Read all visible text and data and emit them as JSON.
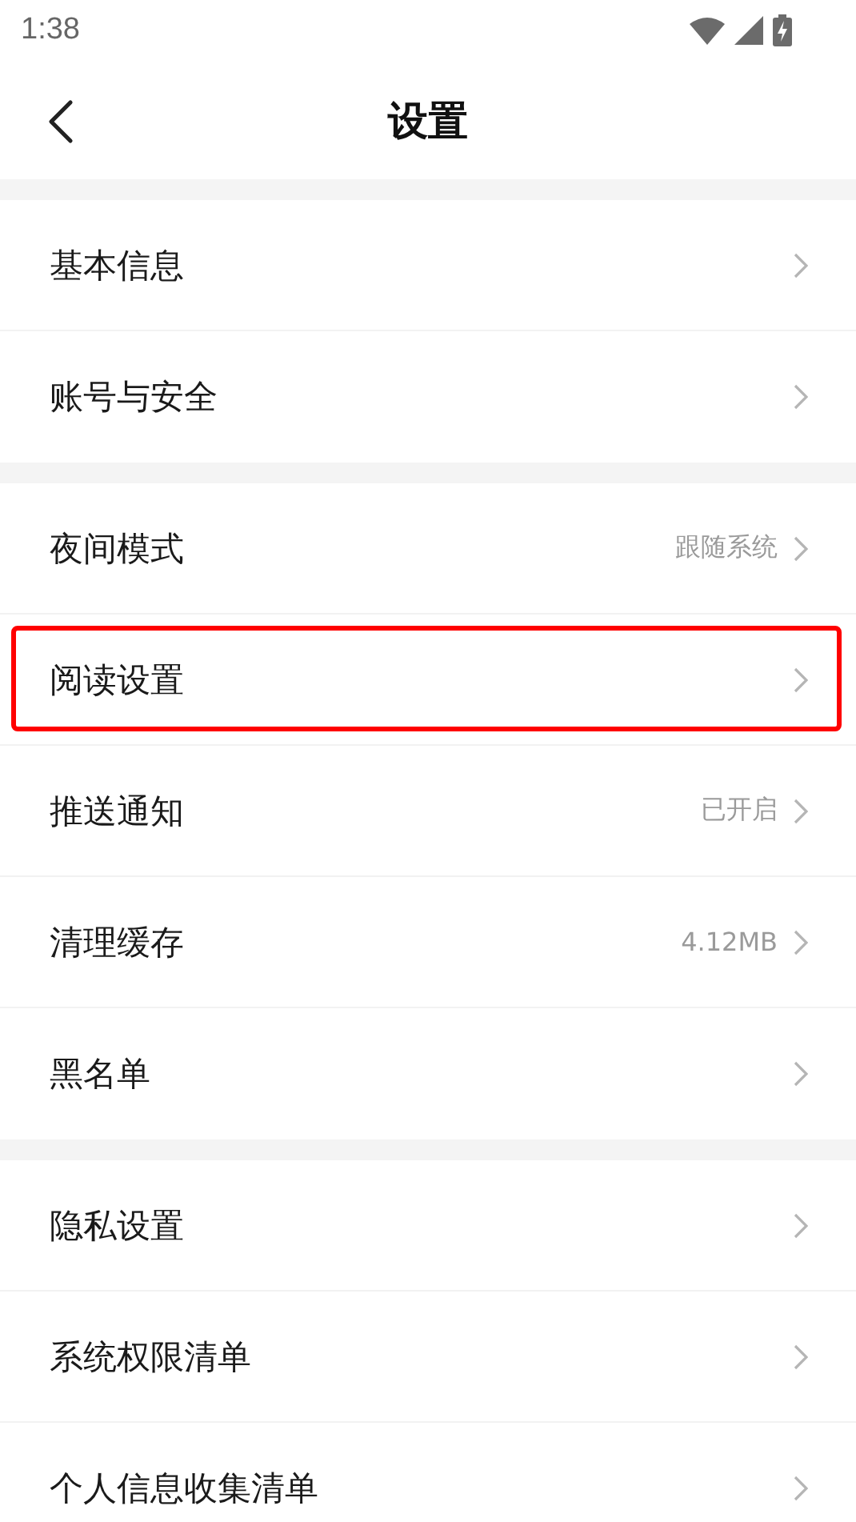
{
  "status_bar": {
    "time": "1:38"
  },
  "header": {
    "title": "设置"
  },
  "groups": [
    {
      "items": [
        {
          "label": "基本信息",
          "highlighted": false
        },
        {
          "label": "账号与安全",
          "highlighted": false
        }
      ]
    },
    {
      "items": [
        {
          "label": "夜间模式",
          "value": "跟随系统",
          "highlighted": false
        },
        {
          "label": "阅读设置",
          "highlighted": true
        },
        {
          "label": "推送通知",
          "value": "已开启",
          "highlighted": false
        },
        {
          "label": "清理缓存",
          "value": "4.12MB",
          "highlighted": false
        },
        {
          "label": "黑名单",
          "highlighted": false
        }
      ]
    },
    {
      "items": [
        {
          "label": "隐私设置",
          "highlighted": false
        },
        {
          "label": "系统权限清单",
          "highlighted": false
        },
        {
          "label": "个人信息收集清单",
          "highlighted": false
        }
      ]
    }
  ]
}
